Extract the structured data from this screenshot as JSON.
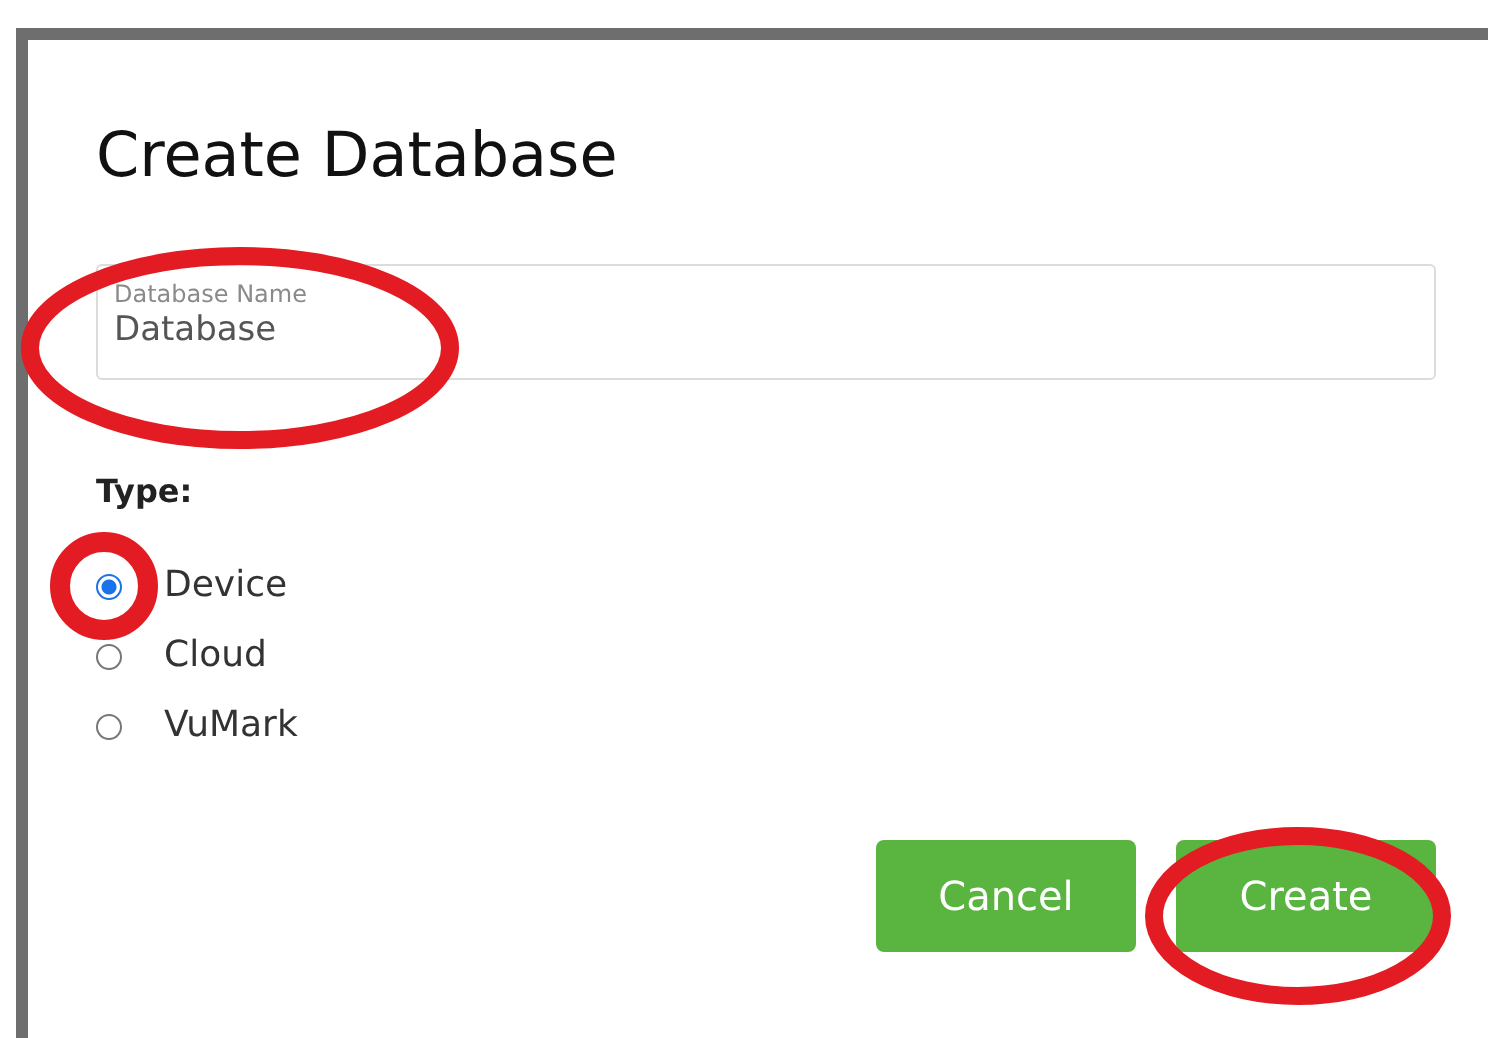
{
  "dialog": {
    "title": "Create Database"
  },
  "name_field": {
    "label": "Database Name",
    "value": "Database"
  },
  "type": {
    "label": "Type:",
    "options": [
      {
        "label": "Device",
        "selected": true
      },
      {
        "label": "Cloud",
        "selected": false
      },
      {
        "label": "VuMark",
        "selected": false
      }
    ]
  },
  "buttons": [
    {
      "label": "Cancel"
    },
    {
      "label": "Create"
    }
  ]
}
